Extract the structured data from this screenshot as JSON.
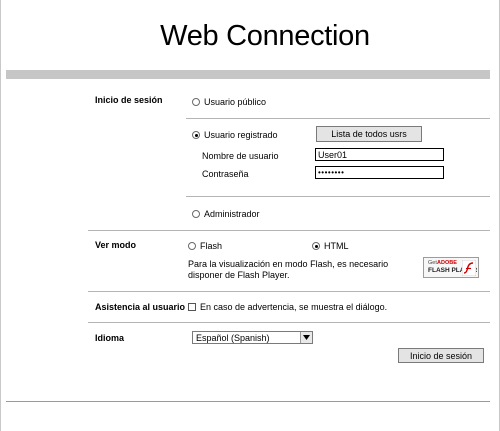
{
  "app": {
    "title": "Web Connection"
  },
  "login": {
    "section_label": "Inicio de sesión",
    "public_user_label": "Usuario público",
    "registered_user_label": "Usuario registrado",
    "list_users_button": "Lista de todos usrs",
    "username_label": "Nombre de usuario",
    "username_value": "User01",
    "password_label": "Contraseña",
    "password_value": "••••••••",
    "admin_label": "Administrador",
    "selected_mode": "registered"
  },
  "view_mode": {
    "section_label": "Ver modo",
    "flash_label": "Flash",
    "html_label": "HTML",
    "selected": "HTML",
    "note": "Para la visualización en modo Flash, es necesario disponer de Flash Player.",
    "badge": {
      "get": "Get",
      "adobe": "ADOBE",
      "player": "FLASH PLAYER"
    }
  },
  "assist": {
    "section_label": "Asistencia al usuario",
    "checkbox_label": "En caso de advertencia, se muestra el diálogo.",
    "checked": false
  },
  "language": {
    "section_label": "Idioma",
    "selected_value": "Español (Spanish)"
  },
  "submit": {
    "label": "Inicio de sesión"
  }
}
